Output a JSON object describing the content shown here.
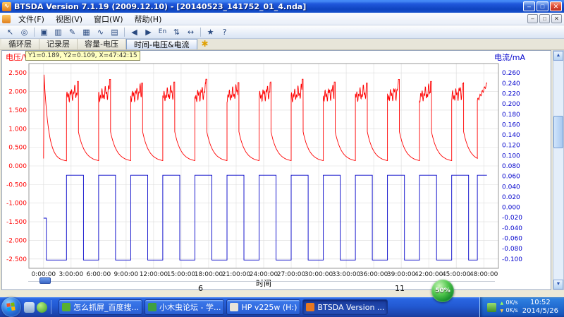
{
  "window": {
    "title": "BTSDA Version 7.1.19 (2009.12.10)  - [20140523_141752_01_4.nda]"
  },
  "icons": {
    "app": "∿",
    "minimize": "–",
    "maximize": "□",
    "close": "✕",
    "child_minimize": "–",
    "child_restore": "□",
    "child_close": "✕",
    "scroll_up": "▲",
    "scroll_down": "▼",
    "tab_star": "✱",
    "up_arrow": "▲",
    "down_arrow": "▼"
  },
  "menu_bar": {
    "items": [
      {
        "label": "文件(F)"
      },
      {
        "label": "视图(V)"
      },
      {
        "label": "窗口(W)"
      },
      {
        "label": "帮助(H)"
      }
    ]
  },
  "toolbar": {
    "buttons": [
      {
        "name": "cursor-tool",
        "glyph": "↖"
      },
      {
        "name": "zoom-tool",
        "glyph": "◎"
      },
      {
        "name": "separator"
      },
      {
        "name": "settings-tool",
        "glyph": "▣"
      },
      {
        "name": "report-view",
        "glyph": "▥"
      },
      {
        "name": "annotate-tool",
        "glyph": "✎"
      },
      {
        "name": "data-grid-view",
        "glyph": "▦"
      },
      {
        "name": "curve-view",
        "glyph": "∿"
      },
      {
        "name": "bar-view",
        "glyph": "▤"
      },
      {
        "name": "separator"
      },
      {
        "name": "prev-record",
        "glyph": "◀"
      },
      {
        "name": "next-record",
        "glyph": "▶"
      },
      {
        "name": "language-english",
        "glyph": "En"
      },
      {
        "name": "sort-toggle",
        "glyph": "⇅"
      },
      {
        "name": "pan-tool",
        "glyph": "↔"
      },
      {
        "name": "separator"
      },
      {
        "name": "marker-tool",
        "glyph": "★"
      },
      {
        "name": "help-tool",
        "glyph": "?"
      }
    ]
  },
  "tabs": {
    "items": [
      {
        "label": "循环层",
        "active": false
      },
      {
        "label": "记录层",
        "active": false
      },
      {
        "label": "容量-电压",
        "active": false
      },
      {
        "label": "时间-电压&电流",
        "active": true
      }
    ]
  },
  "chart": {
    "tooltip": {
      "text": "Y1=0.189, Y2=0.109, X=47:42:15"
    },
    "left_axis": {
      "label": "电压/V",
      "color": "#FF0000",
      "tick_values": [
        2.5,
        2.0,
        1.5,
        1.0,
        0.5,
        0.0,
        -0.5,
        -1.0,
        -1.5,
        -2.0,
        -2.5
      ],
      "tick_labels": [
        "2.500",
        "2.000",
        "1.500",
        "1.000",
        "0.500",
        "0.000",
        "-0.500",
        "-1.000",
        "-1.500",
        "-2.000",
        "-2.500"
      ]
    },
    "right_axis": {
      "label": "电流/mA",
      "color": "#0000CC",
      "tick_values": [
        0.26,
        0.24,
        0.22,
        0.2,
        0.18,
        0.16,
        0.14,
        0.12,
        0.1,
        0.08,
        0.06,
        0.04,
        0.02,
        0.0,
        -0.02,
        -0.04,
        -0.06,
        -0.08,
        -0.1
      ],
      "tick_labels": [
        "0.260",
        "0.240",
        "0.220",
        "0.200",
        "0.180",
        "0.160",
        "0.140",
        "0.120",
        "0.100",
        "0.080",
        "0.060",
        "0.040",
        "0.020",
        "0.000",
        "-0.020",
        "-0.040",
        "-0.060",
        "-0.080",
        "-0.100"
      ]
    },
    "x_axis": {
      "label": "时间",
      "view_min_h": -1.6,
      "view_max_h": 49.6,
      "tick_hours": [
        0,
        3,
        6,
        9,
        12,
        15,
        18,
        21,
        24,
        27,
        30,
        33,
        36,
        39,
        42,
        45,
        48
      ],
      "tick_labels": [
        "0:00:00",
        "3:00:00",
        "6:00:00",
        "9:00:00",
        "12:00:00",
        "15:00:00",
        "18:00:00",
        "21:00:00",
        "24:00:00",
        "27:00:00",
        "30:00:00",
        "33:00:00",
        "36:00:00",
        "39:00:00",
        "42:00:00",
        "45:00:00",
        "48:00:00"
      ]
    }
  },
  "chart_data": {
    "type": "line",
    "title": "",
    "xlabel": "时间",
    "x_range_hours": [
      0,
      48.35
    ],
    "left_ylabel": "电压/V",
    "right_ylabel": "电流/mA",
    "left_ylim": [
      -2.75,
      2.75
    ],
    "right_ylim": [
      -0.118,
      0.278
    ],
    "grid": true,
    "series": [
      {
        "name": "电压",
        "axis": "left",
        "unit": "V",
        "color": "#FF0000",
        "description": "13 charge/discharge cycles: jagged charge plateau about 1.6-2.3 V peaking near 2.3 V, vertical drop to 0.92 V, exponential decay to about 0.11 V; initial spike to 2.45 V at t=0; final rise to about 2.2 V near 48 h"
      },
      {
        "name": "电流",
        "axis": "right",
        "unit": "mA",
        "color": "#0000C8",
        "description": "square wave alternating between +0.062 mA and -0.102 mA synchronized with cycles; brief -0.021 mA step at start"
      }
    ],
    "pattern": {
      "initial": {
        "v_start": 0.2,
        "spike_t": 0.05,
        "v_peak": 2.45,
        "tau_h": 0.5,
        "end_h": 2.5,
        "v_floor": 0.12
      },
      "cycle": {
        "first_start_h": 2.5,
        "period_h": 3.5,
        "count": 13,
        "charge_h": 1.3,
        "v_base": 1.85,
        "v_peak": 2.27,
        "v_drop": 0.92,
        "v_floor": 0.11,
        "decay_k": 3.2
      },
      "final": {
        "start_h": 47.3,
        "end_h": 48.35,
        "v_jump": 1.75,
        "v_end": 2.2
      },
      "current": {
        "high_mA": 0.062,
        "low_mA": -0.102,
        "high_h": 1.85,
        "initial": [
          {
            "from": 0,
            "to": 0.3,
            "mA": -0.021
          },
          {
            "from": 0.3,
            "to": 2.5,
            "mA": -0.102
          }
        ]
      }
    }
  },
  "bottom_bar": {
    "left_label": "6",
    "right_label": "11"
  },
  "taskbar": {
    "tasks": [
      {
        "label": "怎么抓屏_百度搜...",
        "icon_color": "#58B030",
        "active": false
      },
      {
        "label": "小木虫论坛 - 学...",
        "icon_color": "#3FA040",
        "active": false
      },
      {
        "label": "HP v225w (H:)",
        "icon_color": "#E8E4D8",
        "active": false
      },
      {
        "label": "BTSDA Version ...",
        "icon_color": "#E87820",
        "active": true
      }
    ],
    "tray": {
      "ball_percent": "50%",
      "up_speed": "0K/s",
      "down_speed": "0K/s",
      "time": "10:52",
      "date": "2014/5/26"
    }
  }
}
